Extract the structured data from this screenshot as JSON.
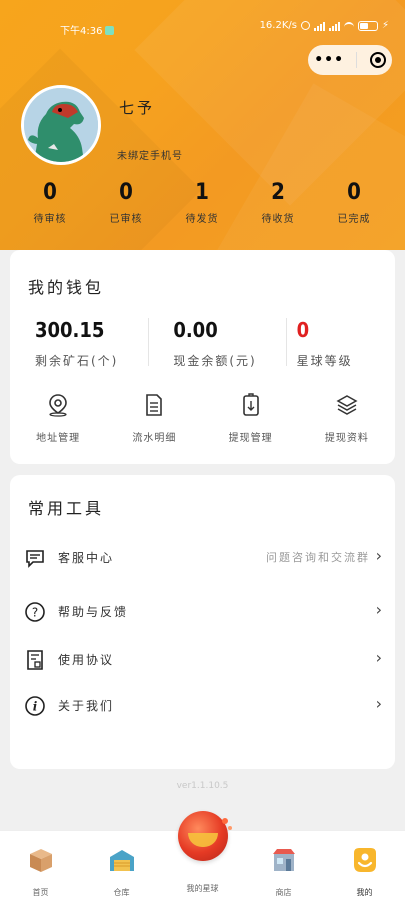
{
  "status_bar": {
    "time": "下午4:36",
    "network_speed": "16.2K/s"
  },
  "profile": {
    "username": "七予",
    "phone_status": "未绑定手机号"
  },
  "order_counts": [
    {
      "value": "0",
      "label": "待审核"
    },
    {
      "value": "0",
      "label": "已审核"
    },
    {
      "value": "1",
      "label": "待发货"
    },
    {
      "value": "2",
      "label": "待收货"
    },
    {
      "value": "0",
      "label": "已完成"
    }
  ],
  "wallet": {
    "title": "我的钱包",
    "stats": [
      {
        "value": "300.15",
        "label": "剩余矿石(个)"
      },
      {
        "value": "0.00",
        "label": "现金余额(元)"
      },
      {
        "value": "0",
        "label": "星球等级"
      }
    ],
    "actions": [
      {
        "label": "地址管理",
        "icon": "location-pin-icon"
      },
      {
        "label": "流水明细",
        "icon": "document-icon"
      },
      {
        "label": "提现管理",
        "icon": "withdraw-icon"
      },
      {
        "label": "提现资料",
        "icon": "layers-icon"
      }
    ]
  },
  "tools": {
    "title": "常用工具",
    "items": [
      {
        "label": "客服中心",
        "hint": "问题咨询和交流群",
        "icon": "chat-icon"
      },
      {
        "label": "帮助与反馈",
        "hint": "",
        "icon": "question-icon"
      },
      {
        "label": "使用协议",
        "hint": "",
        "icon": "agreement-icon"
      },
      {
        "label": "关于我们",
        "hint": "",
        "icon": "info-icon"
      }
    ]
  },
  "version": "ver1.1.10.5",
  "tabbar": [
    {
      "label": "首页",
      "icon": "box-icon"
    },
    {
      "label": "仓库",
      "icon": "warehouse-icon"
    },
    {
      "label": "我的星球",
      "icon": "planet-icon"
    },
    {
      "label": "商店",
      "icon": "store-icon"
    },
    {
      "label": "我的",
      "icon": "profile-icon"
    }
  ],
  "colors": {
    "header_orange": "#f6a21f",
    "level_red": "#e02020",
    "card_bg": "#ffffff",
    "page_bg": "#f0f0f0"
  }
}
